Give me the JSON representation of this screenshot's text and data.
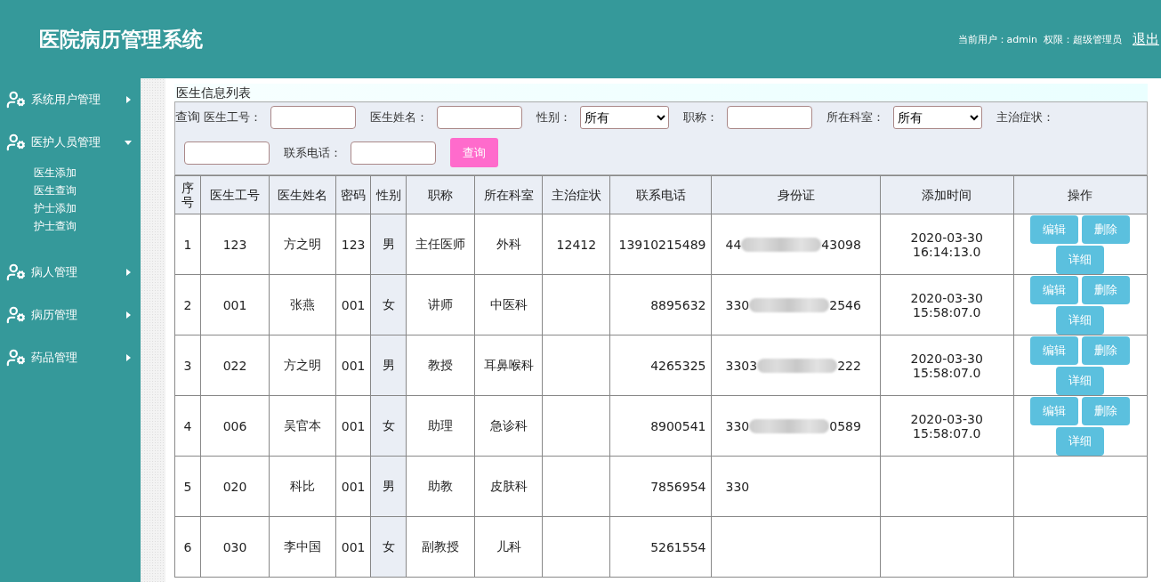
{
  "header": {
    "title": "医院病历管理系统",
    "user_info": "当前用户：admin  权限：超级管理员",
    "logout": "退出"
  },
  "sidebar": {
    "items": [
      {
        "label": "系统用户管理",
        "expanded": false
      },
      {
        "label": "医护人员管理",
        "expanded": true,
        "children": [
          {
            "label": "医生添加"
          },
          {
            "label": "医生查询"
          },
          {
            "label": "护士添加"
          },
          {
            "label": "护士查询"
          }
        ]
      },
      {
        "label": "病人管理",
        "expanded": false
      },
      {
        "label": "病历管理",
        "expanded": false
      },
      {
        "label": "药品管理",
        "expanded": false
      }
    ]
  },
  "panel": {
    "title": "医生信息列表"
  },
  "search": {
    "prefix": "查询",
    "fields": [
      {
        "label": "医生工号：",
        "kind": "text"
      },
      {
        "label": "医生姓名：",
        "kind": "text"
      },
      {
        "label": "性别：",
        "kind": "select",
        "value": "所有"
      },
      {
        "label": "职称：",
        "kind": "text"
      },
      {
        "label": "所在科室：",
        "kind": "select",
        "value": "所有"
      },
      {
        "label": "主治症状：",
        "kind": "text"
      },
      {
        "label": "联系电话：",
        "kind": "text"
      }
    ],
    "button": "查询"
  },
  "table": {
    "columns": [
      "序号",
      "医生工号",
      "医生姓名",
      "密码",
      "性别",
      "职称",
      "所在科室",
      "主治症状",
      "联系电话",
      "身份证",
      "添加时间",
      "操作"
    ],
    "rows": [
      {
        "cells": [
          "1",
          "123",
          "方之明",
          "123",
          "男",
          "主任医师",
          "外科",
          "12412",
          "13910215489"
        ],
        "id_start": "44",
        "id_end": "43098",
        "time": "2020-03-30 16:14:13.0",
        "actions": [
          "编辑",
          "删除",
          "详细"
        ]
      },
      {
        "cells": [
          "2",
          "001",
          "张燕",
          "001",
          "女",
          "讲师",
          "中医科",
          "",
          "8895632"
        ],
        "id_start": "330",
        "id_end": "2546",
        "time": "2020-03-30 15:58:07.0",
        "actions": [
          "编辑",
          "删除",
          "详细"
        ]
      },
      {
        "cells": [
          "3",
          "022",
          "方之明",
          "001",
          "男",
          "教授",
          "耳鼻喉科",
          "",
          "4265325"
        ],
        "id_start": "3303",
        "id_end": "222",
        "time": "2020-03-30 15:58:07.0",
        "actions": [
          "编辑",
          "删除",
          "详细"
        ]
      },
      {
        "cells": [
          "4",
          "006",
          "吴官本",
          "001",
          "女",
          "助理",
          "急诊科",
          "",
          "8900541"
        ],
        "id_start": "330",
        "id_end": "0589",
        "time": "2020-03-30 15:58:07.0",
        "actions": [
          "编辑",
          "删除",
          "详细"
        ]
      },
      {
        "cells": [
          "5",
          "020",
          "科比",
          "001",
          "男",
          "助教",
          "皮肤科",
          "",
          "7856954"
        ],
        "id_start": "330"
      },
      {
        "cells": [
          "6",
          "030",
          "李中国",
          "001",
          "女",
          "副教授",
          "儿科",
          "",
          "5261554"
        ]
      }
    ]
  }
}
